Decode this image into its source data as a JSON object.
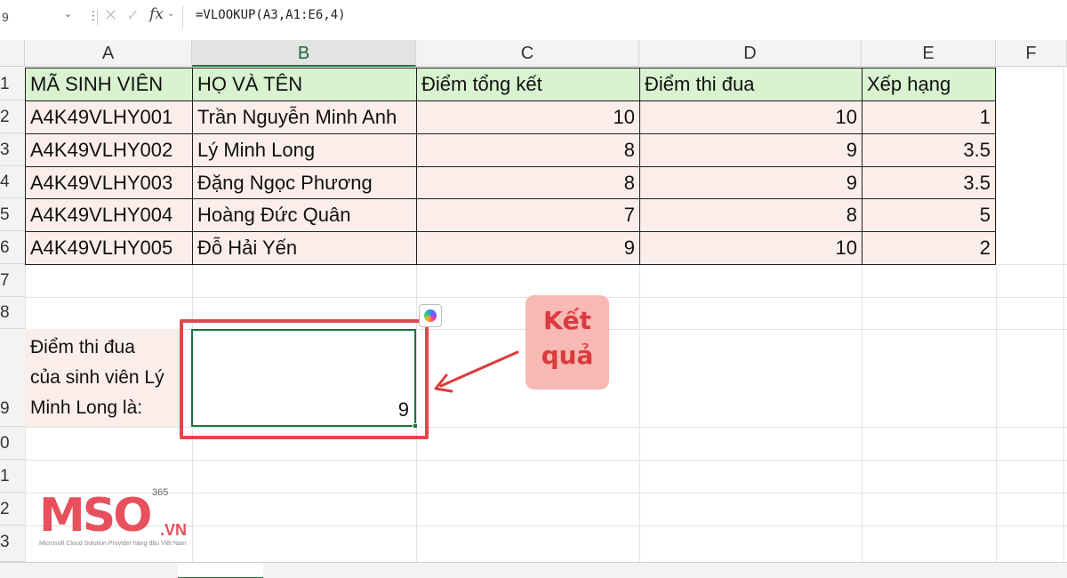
{
  "formula_bar": {
    "name_box": "9",
    "formula": "=VLOOKUP(A3,A1:E6,4)"
  },
  "columns": [
    "A",
    "B",
    "C",
    "D",
    "E",
    "F"
  ],
  "rows": [
    "1",
    "2",
    "3",
    "4",
    "5",
    "6",
    "7",
    "8",
    "9",
    "0",
    "1",
    "2",
    "3"
  ],
  "table": {
    "headers": [
      "MÃ SINH VIÊN",
      "HỌ VÀ TÊN",
      "Điểm tổng kết",
      "Điểm thi đua",
      "Xếp hạng"
    ],
    "rows": [
      [
        "A4K49VLHY001",
        "Trần Nguyễn Minh Anh",
        "10",
        "10",
        "1"
      ],
      [
        "A4K49VLHY002",
        "Lý Minh Long",
        "8",
        "9",
        "3.5"
      ],
      [
        "A4K49VLHY003",
        "Đặng Ngọc Phương",
        "8",
        "9",
        "3.5"
      ],
      [
        "A4K49VLHY004",
        "Hoàng Đức Quân",
        "7",
        "8",
        "5"
      ],
      [
        "A4K49VLHY005",
        "Đỗ Hải Yến",
        "9",
        "10",
        "2"
      ]
    ]
  },
  "label_cell": {
    "line1": "Điểm thi đua",
    "line2": "của sinh viên Lý",
    "line3": "Minh Long là:"
  },
  "result_value": "9",
  "callout": {
    "line1": "Kết",
    "line2": "quả"
  },
  "logo": {
    "text": "MSO",
    "superscript": "365",
    "suffix": ".VN",
    "tagline": "Microsoft Cloud Solution Provider hàng đầu Việt Nam"
  },
  "colors": {
    "header_fill": "#d9f2d0",
    "data_fill": "#fbeeea",
    "accent_red": "#e0474c",
    "excel_green": "#1e7145"
  }
}
